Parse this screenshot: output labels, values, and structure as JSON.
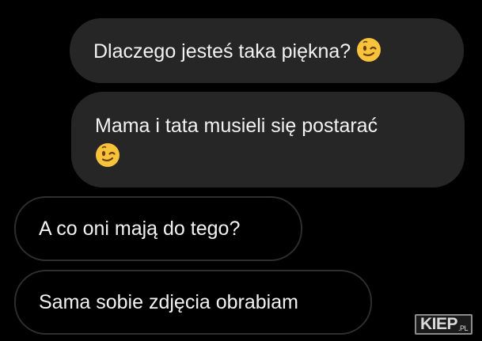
{
  "messages": [
    {
      "direction": "sent",
      "text": "Dlaczego jesteś taka piękna?",
      "emoji": "winking-face"
    },
    {
      "direction": "sent",
      "text": "Mama i tata musieli się postarać",
      "emoji": "winking-face"
    },
    {
      "direction": "received",
      "text": "A co oni mają do tego?"
    },
    {
      "direction": "received",
      "text": "Sama sobie zdjęcia obrabiam"
    }
  ],
  "watermark": {
    "name": "KIEP",
    "suffix": ".PL"
  },
  "colors": {
    "background": "#000000",
    "sent_bubble": "#262626",
    "received_border": "#2e2e2e",
    "text": "#f2f2f2",
    "emoji_face": "#f6c33b"
  }
}
